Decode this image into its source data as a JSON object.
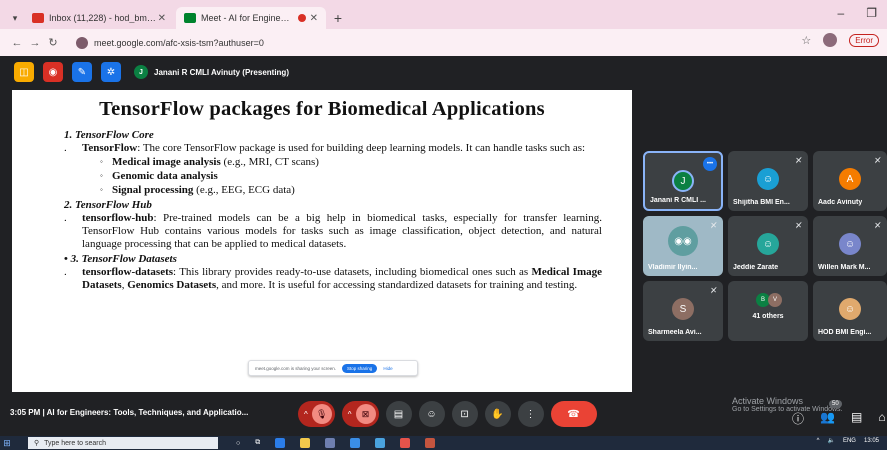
{
  "browser": {
    "tabs": [
      {
        "label": "Inbox (11,228) - hod_bmie@av",
        "active": false,
        "favicon_color": "#d93025"
      },
      {
        "label": "Meet - AI for Engineers: To",
        "active": true,
        "favicon_color": "#00832d"
      }
    ],
    "url": "meet.google.com/afc-xsis-tsm?authuser=0",
    "error_label": "Error"
  },
  "meet": {
    "presenter_initial": "J",
    "presenter_label": "Janani R CMLI Avinuty (Presenting)",
    "time": "3:05 PM",
    "meeting_title": "AI for Engineers: Tools, Techniques, and Applicatio...",
    "share_bar": {
      "text": "meet.google.com is sharing your screen.",
      "stop_label": "Stop sharing",
      "hide_label": "Hide"
    },
    "activate_windows": {
      "line1": "Activate Windows",
      "line2": "Go to Settings to activate Windows."
    },
    "chat_badge": "50"
  },
  "slide": {
    "title": "TensorFlow packages for Biomedical Applications",
    "sec1": "1. TensorFlow Core",
    "item1_bold": "TensorFlow",
    "item1_text": ": The core TensorFlow package is used for building deep learning models. It can handle tasks such as:",
    "sub1_bold": "Medical image analysis",
    "sub1_text": " (e.g., MRI, CT scans)",
    "sub2_bold": "Genomic data analysis",
    "sub3_bold": "Signal processing",
    "sub3_text": " (e.g., EEG, ECG data)",
    "sec2": "2. TensorFlow Hub",
    "item2_bold": "tensorflow-hub",
    "item2_text": ": Pre-trained models can be a big help in biomedical tasks, especially for transfer learning. TensorFlow Hub contains various models for tasks such as image classification, object detection, and natural language processing that can be applied to medical datasets.",
    "sec3": "3. TensorFlow Datasets",
    "item3_bold": "tensorflow-datasets",
    "item3_text_a": ": This library provides ready-to-use datasets, including biomedical ones such as ",
    "item3_bold_b": "Medical Image Datasets",
    "item3_text_b": ", ",
    "item3_bold_c": "Genomics Datasets",
    "item3_text_c": ", and more. It is useful for accessing standardized datasets for training and testing."
  },
  "participants": [
    {
      "name": "Janani R CMLI ...",
      "initial": "J",
      "color": "#0b8043"
    },
    {
      "name": "Shijitha BMI En...",
      "initial": "",
      "color": "#1a9fd4"
    },
    {
      "name": "Aadc Avinuty",
      "initial": "A",
      "color": "#f57c00"
    },
    {
      "name": "Vladimir Ilyin...",
      "initial": "",
      "color": "#5f9ea0"
    },
    {
      "name": "Jeddie Zarate",
      "initial": "",
      "color": "#26a69a"
    },
    {
      "name": "Willen Mark M...",
      "initial": "",
      "color": "#7986cb"
    },
    {
      "name": "Sharmeela Avi...",
      "initial": "S",
      "color": "#8d6e63"
    },
    {
      "name": "41 others",
      "initial": "B",
      "color": "#0b8043"
    },
    {
      "name": "HOD BMI Engi...",
      "initial": "",
      "color": "#e0a96d"
    }
  ],
  "taskbar": {
    "search_placeholder": "Type here to search",
    "lang": "ENG",
    "time": "13:05"
  }
}
